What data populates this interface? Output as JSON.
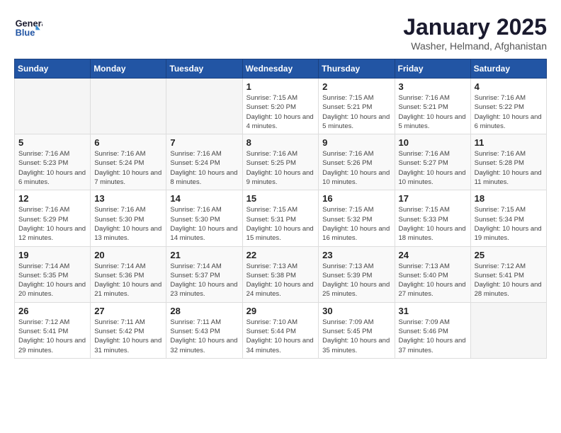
{
  "header": {
    "logo": {
      "line1": "General",
      "line2": "Blue"
    },
    "title": "January 2025",
    "subtitle": "Washer, Helmand, Afghanistan"
  },
  "weekdays": [
    "Sunday",
    "Monday",
    "Tuesday",
    "Wednesday",
    "Thursday",
    "Friday",
    "Saturday"
  ],
  "weeks": [
    [
      {
        "day": "",
        "info": ""
      },
      {
        "day": "",
        "info": ""
      },
      {
        "day": "",
        "info": ""
      },
      {
        "day": "1",
        "sunrise": "Sunrise: 7:15 AM",
        "sunset": "Sunset: 5:20 PM",
        "daylight": "Daylight: 10 hours and 4 minutes."
      },
      {
        "day": "2",
        "sunrise": "Sunrise: 7:15 AM",
        "sunset": "Sunset: 5:21 PM",
        "daylight": "Daylight: 10 hours and 5 minutes."
      },
      {
        "day": "3",
        "sunrise": "Sunrise: 7:16 AM",
        "sunset": "Sunset: 5:21 PM",
        "daylight": "Daylight: 10 hours and 5 minutes."
      },
      {
        "day": "4",
        "sunrise": "Sunrise: 7:16 AM",
        "sunset": "Sunset: 5:22 PM",
        "daylight": "Daylight: 10 hours and 6 minutes."
      }
    ],
    [
      {
        "day": "5",
        "sunrise": "Sunrise: 7:16 AM",
        "sunset": "Sunset: 5:23 PM",
        "daylight": "Daylight: 10 hours and 6 minutes."
      },
      {
        "day": "6",
        "sunrise": "Sunrise: 7:16 AM",
        "sunset": "Sunset: 5:24 PM",
        "daylight": "Daylight: 10 hours and 7 minutes."
      },
      {
        "day": "7",
        "sunrise": "Sunrise: 7:16 AM",
        "sunset": "Sunset: 5:24 PM",
        "daylight": "Daylight: 10 hours and 8 minutes."
      },
      {
        "day": "8",
        "sunrise": "Sunrise: 7:16 AM",
        "sunset": "Sunset: 5:25 PM",
        "daylight": "Daylight: 10 hours and 9 minutes."
      },
      {
        "day": "9",
        "sunrise": "Sunrise: 7:16 AM",
        "sunset": "Sunset: 5:26 PM",
        "daylight": "Daylight: 10 hours and 10 minutes."
      },
      {
        "day": "10",
        "sunrise": "Sunrise: 7:16 AM",
        "sunset": "Sunset: 5:27 PM",
        "daylight": "Daylight: 10 hours and 10 minutes."
      },
      {
        "day": "11",
        "sunrise": "Sunrise: 7:16 AM",
        "sunset": "Sunset: 5:28 PM",
        "daylight": "Daylight: 10 hours and 11 minutes."
      }
    ],
    [
      {
        "day": "12",
        "sunrise": "Sunrise: 7:16 AM",
        "sunset": "Sunset: 5:29 PM",
        "daylight": "Daylight: 10 hours and 12 minutes."
      },
      {
        "day": "13",
        "sunrise": "Sunrise: 7:16 AM",
        "sunset": "Sunset: 5:30 PM",
        "daylight": "Daylight: 10 hours and 13 minutes."
      },
      {
        "day": "14",
        "sunrise": "Sunrise: 7:16 AM",
        "sunset": "Sunset: 5:30 PM",
        "daylight": "Daylight: 10 hours and 14 minutes."
      },
      {
        "day": "15",
        "sunrise": "Sunrise: 7:15 AM",
        "sunset": "Sunset: 5:31 PM",
        "daylight": "Daylight: 10 hours and 15 minutes."
      },
      {
        "day": "16",
        "sunrise": "Sunrise: 7:15 AM",
        "sunset": "Sunset: 5:32 PM",
        "daylight": "Daylight: 10 hours and 16 minutes."
      },
      {
        "day": "17",
        "sunrise": "Sunrise: 7:15 AM",
        "sunset": "Sunset: 5:33 PM",
        "daylight": "Daylight: 10 hours and 18 minutes."
      },
      {
        "day": "18",
        "sunrise": "Sunrise: 7:15 AM",
        "sunset": "Sunset: 5:34 PM",
        "daylight": "Daylight: 10 hours and 19 minutes."
      }
    ],
    [
      {
        "day": "19",
        "sunrise": "Sunrise: 7:14 AM",
        "sunset": "Sunset: 5:35 PM",
        "daylight": "Daylight: 10 hours and 20 minutes."
      },
      {
        "day": "20",
        "sunrise": "Sunrise: 7:14 AM",
        "sunset": "Sunset: 5:36 PM",
        "daylight": "Daylight: 10 hours and 21 minutes."
      },
      {
        "day": "21",
        "sunrise": "Sunrise: 7:14 AM",
        "sunset": "Sunset: 5:37 PM",
        "daylight": "Daylight: 10 hours and 23 minutes."
      },
      {
        "day": "22",
        "sunrise": "Sunrise: 7:13 AM",
        "sunset": "Sunset: 5:38 PM",
        "daylight": "Daylight: 10 hours and 24 minutes."
      },
      {
        "day": "23",
        "sunrise": "Sunrise: 7:13 AM",
        "sunset": "Sunset: 5:39 PM",
        "daylight": "Daylight: 10 hours and 25 minutes."
      },
      {
        "day": "24",
        "sunrise": "Sunrise: 7:13 AM",
        "sunset": "Sunset: 5:40 PM",
        "daylight": "Daylight: 10 hours and 27 minutes."
      },
      {
        "day": "25",
        "sunrise": "Sunrise: 7:12 AM",
        "sunset": "Sunset: 5:41 PM",
        "daylight": "Daylight: 10 hours and 28 minutes."
      }
    ],
    [
      {
        "day": "26",
        "sunrise": "Sunrise: 7:12 AM",
        "sunset": "Sunset: 5:41 PM",
        "daylight": "Daylight: 10 hours and 29 minutes."
      },
      {
        "day": "27",
        "sunrise": "Sunrise: 7:11 AM",
        "sunset": "Sunset: 5:42 PM",
        "daylight": "Daylight: 10 hours and 31 minutes."
      },
      {
        "day": "28",
        "sunrise": "Sunrise: 7:11 AM",
        "sunset": "Sunset: 5:43 PM",
        "daylight": "Daylight: 10 hours and 32 minutes."
      },
      {
        "day": "29",
        "sunrise": "Sunrise: 7:10 AM",
        "sunset": "Sunset: 5:44 PM",
        "daylight": "Daylight: 10 hours and 34 minutes."
      },
      {
        "day": "30",
        "sunrise": "Sunrise: 7:09 AM",
        "sunset": "Sunset: 5:45 PM",
        "daylight": "Daylight: 10 hours and 35 minutes."
      },
      {
        "day": "31",
        "sunrise": "Sunrise: 7:09 AM",
        "sunset": "Sunset: 5:46 PM",
        "daylight": "Daylight: 10 hours and 37 minutes."
      },
      {
        "day": "",
        "info": ""
      }
    ]
  ]
}
